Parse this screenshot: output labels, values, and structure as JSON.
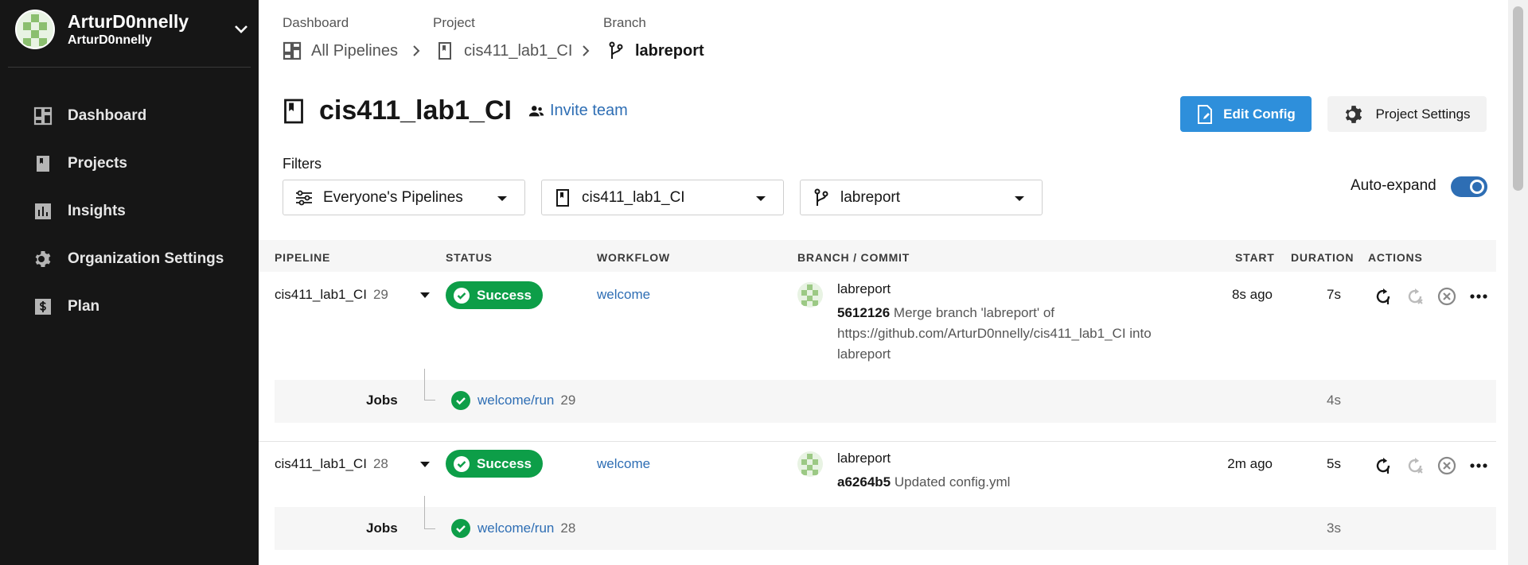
{
  "user": {
    "name": "ArturD0nnelly",
    "org": "ArturD0nnelly"
  },
  "sidebar": {
    "items": [
      {
        "label": "Dashboard",
        "icon": "dashboard-icon"
      },
      {
        "label": "Projects",
        "icon": "projects-icon"
      },
      {
        "label": "Insights",
        "icon": "insights-icon"
      },
      {
        "label": "Organization Settings",
        "icon": "gear-icon"
      },
      {
        "label": "Plan",
        "icon": "dollar-icon"
      }
    ]
  },
  "breadcrumb": {
    "headings": [
      "Dashboard",
      "Project",
      "Branch"
    ],
    "items": [
      "All Pipelines",
      "cis411_lab1_CI",
      "labreport"
    ]
  },
  "header": {
    "title": "cis411_lab1_CI",
    "invite": "Invite team",
    "edit_config": "Edit Config",
    "project_settings": "Project Settings"
  },
  "filters": {
    "label": "Filters",
    "pipelines": "Everyone's Pipelines",
    "project": "cis411_lab1_CI",
    "branch": "labreport",
    "auto_expand_label": "Auto-expand",
    "auto_expand_on": true
  },
  "table": {
    "headers": [
      "PIPELINE",
      "STATUS",
      "WORKFLOW",
      "BRANCH / COMMIT",
      "START",
      "DURATION",
      "ACTIONS"
    ],
    "rows": [
      {
        "pipeline": "cis411_lab1_CI",
        "number": "29",
        "status": "Success",
        "workflow": "welcome",
        "branch": "labreport",
        "sha": "5612126",
        "message_line1": "Merge branch 'labreport' of",
        "message_line2": "https://github.com/ArturD0nnelly/cis411_lab1_CI into",
        "message_line3": "labreport",
        "start": "8s ago",
        "duration": "7s",
        "jobs_label": "Jobs",
        "job_name": "welcome/run",
        "job_number": "29",
        "job_duration": "4s"
      },
      {
        "pipeline": "cis411_lab1_CI",
        "number": "28",
        "status": "Success",
        "workflow": "welcome",
        "branch": "labreport",
        "sha": "a6264b5",
        "message_line1": "Updated config.yml",
        "start": "2m ago",
        "duration": "5s",
        "jobs_label": "Jobs",
        "job_name": "welcome/run",
        "job_number": "28",
        "job_duration": "3s"
      }
    ]
  },
  "colors": {
    "sidebar_bg": "#161616",
    "accent": "#2e8fdb",
    "link": "#2e6eb4",
    "success": "#0d9e48"
  }
}
